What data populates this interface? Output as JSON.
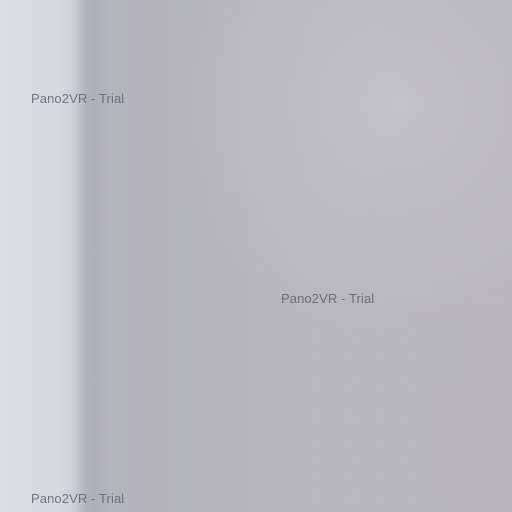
{
  "viewer": {
    "watermarks": [
      {
        "text": "Pano2VR - Trial"
      },
      {
        "text": "Pano2VR - Trial"
      },
      {
        "text": "Pano2VR - Trial"
      }
    ]
  }
}
